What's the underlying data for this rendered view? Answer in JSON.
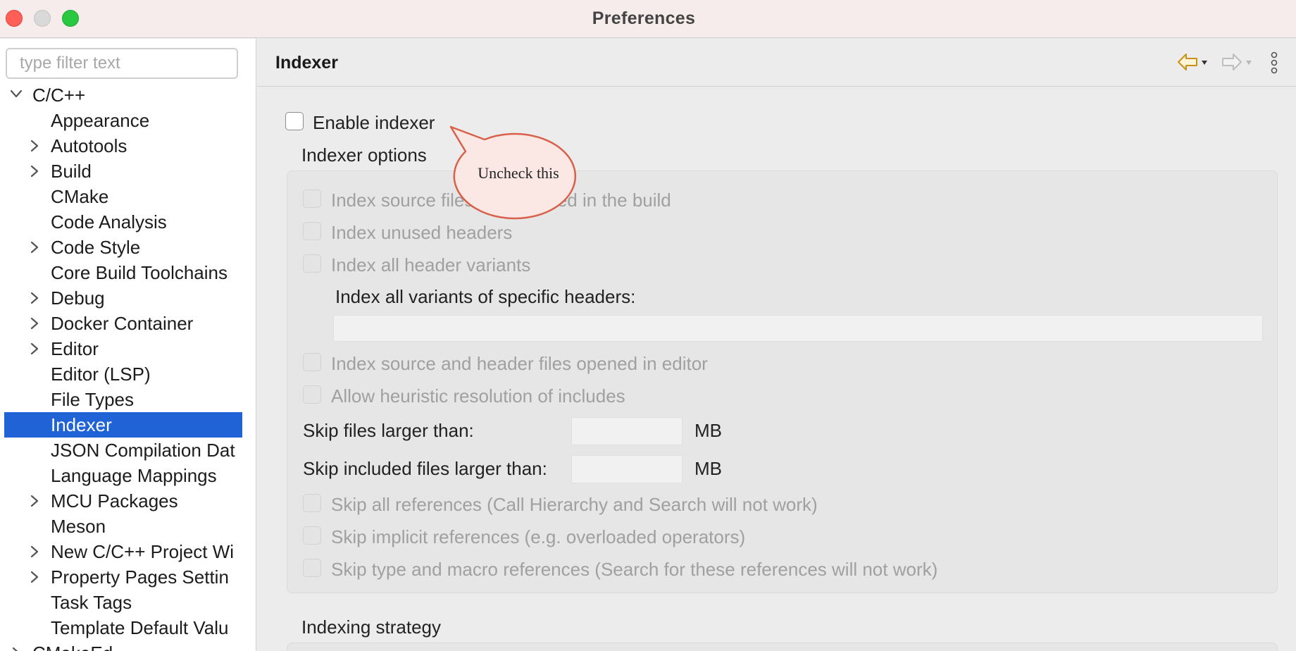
{
  "window": {
    "title": "Preferences"
  },
  "sidebar": {
    "filter_placeholder": "type filter text",
    "items": [
      {
        "label": "C/C++",
        "level": 0,
        "expander": "expanded"
      },
      {
        "label": "Appearance",
        "level": 1,
        "expander": "none"
      },
      {
        "label": "Autotools",
        "level": 1,
        "expander": "collapsed"
      },
      {
        "label": "Build",
        "level": 1,
        "expander": "collapsed"
      },
      {
        "label": "CMake",
        "level": 1,
        "expander": "none"
      },
      {
        "label": "Code Analysis",
        "level": 1,
        "expander": "none"
      },
      {
        "label": "Code Style",
        "level": 1,
        "expander": "collapsed"
      },
      {
        "label": "Core Build Toolchains",
        "level": 1,
        "expander": "none"
      },
      {
        "label": "Debug",
        "level": 1,
        "expander": "collapsed"
      },
      {
        "label": "Docker Container",
        "level": 1,
        "expander": "collapsed"
      },
      {
        "label": "Editor",
        "level": 1,
        "expander": "collapsed"
      },
      {
        "label": "Editor (LSP)",
        "level": 1,
        "expander": "none"
      },
      {
        "label": "File Types",
        "level": 1,
        "expander": "none"
      },
      {
        "label": "Indexer",
        "level": 1,
        "expander": "none",
        "selected": true
      },
      {
        "label": "JSON Compilation Dat",
        "level": 1,
        "expander": "none"
      },
      {
        "label": "Language Mappings",
        "level": 1,
        "expander": "none"
      },
      {
        "label": "MCU Packages",
        "level": 1,
        "expander": "collapsed"
      },
      {
        "label": "Meson",
        "level": 1,
        "expander": "none"
      },
      {
        "label": "New C/C++ Project Wi",
        "level": 1,
        "expander": "collapsed"
      },
      {
        "label": "Property Pages Settin",
        "level": 1,
        "expander": "collapsed"
      },
      {
        "label": "Task Tags",
        "level": 1,
        "expander": "none"
      },
      {
        "label": "Template Default Valu",
        "level": 1,
        "expander": "none"
      },
      {
        "label": "CMakeEd",
        "level": 0,
        "expander": "collapsed"
      }
    ]
  },
  "main": {
    "title": "Indexer",
    "enable_indexer": {
      "label": "Enable indexer",
      "checked": false
    },
    "indexer_options_label": "Indexer options",
    "options": {
      "index_source_not_in_build": "Index source files not included in the build",
      "index_unused_headers": "Index unused headers",
      "index_all_header_variants": "Index all header variants",
      "index_all_variants_specific_label": "Index all variants of specific headers:",
      "index_all_variants_specific_value": "",
      "index_opened_in_editor": "Index source and header files opened in editor",
      "allow_heuristic_includes": "Allow heuristic resolution of includes",
      "skip_files_larger_label": "Skip files larger than:",
      "skip_files_larger_value": "",
      "skip_files_larger_unit": "MB",
      "skip_included_larger_label": "Skip included files larger than:",
      "skip_included_larger_value": "",
      "skip_included_larger_unit": "MB",
      "skip_all_references": "Skip all references (Call Hierarchy and Search will not work)",
      "skip_implicit_references": "Skip implicit references (e.g. overloaded operators)",
      "skip_type_macro_references": "Skip type and macro references (Search for these references will not work)"
    },
    "indexing_strategy_label": "Indexing strategy"
  },
  "callout": {
    "text": "Uncheck this"
  },
  "colors": {
    "selection": "#1f63d6",
    "callout_fill": "#fbe7e4",
    "callout_stroke": "#d9604a",
    "back_arrow": "#d4a017"
  }
}
